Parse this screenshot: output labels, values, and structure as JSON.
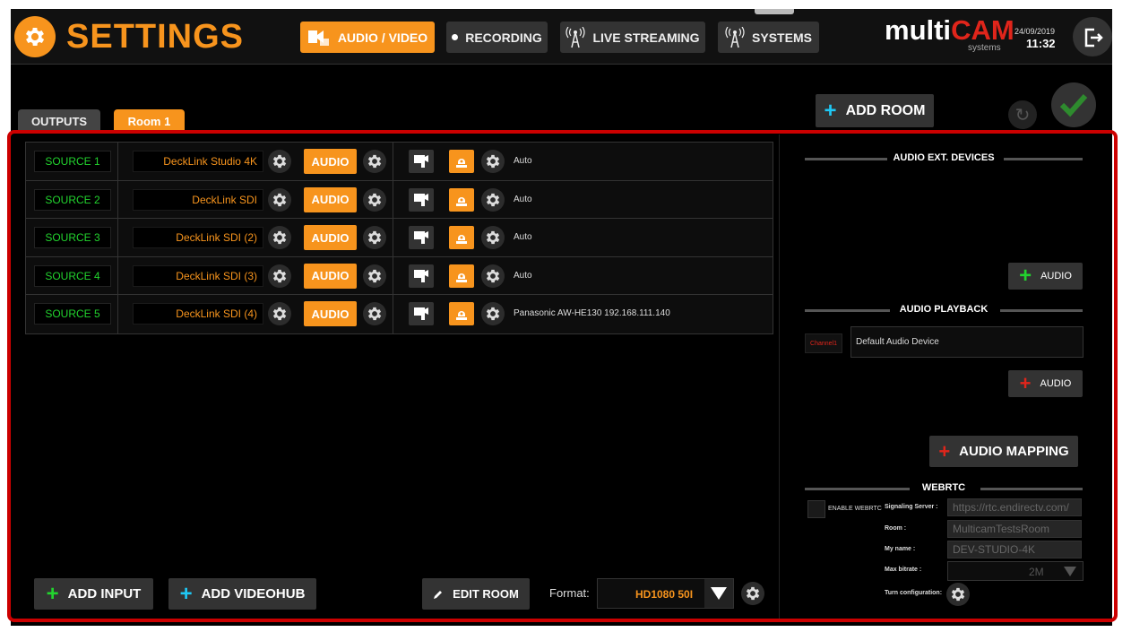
{
  "header": {
    "title": "SETTINGS",
    "nav": [
      {
        "label": "AUDIO / VIDEO",
        "icon": "speaker-video-icon",
        "active": true
      },
      {
        "label": "RECORDING",
        "icon": "record-dot-icon",
        "active": false
      },
      {
        "label": "LIVE STREAMING",
        "icon": "antenna-icon",
        "active": false
      },
      {
        "label": "SYSTEMS",
        "icon": "antenna-icon",
        "active": false
      }
    ],
    "brand_main": "multi",
    "brand_accent": "CAM",
    "brand_sub": "systems",
    "date": "24/09/2019",
    "time": "11:32"
  },
  "tabs": {
    "outputs": "OUTPUTS",
    "room": "Room 1"
  },
  "toolbar": {
    "add_room": "ADD ROOM"
  },
  "sources": [
    {
      "name": "SOURCE 1",
      "device": "DeckLink Studio 4K",
      "audio": "AUDIO",
      "control": "Auto"
    },
    {
      "name": "SOURCE 2",
      "device": "DeckLink SDI",
      "audio": "AUDIO",
      "control": "Auto"
    },
    {
      "name": "SOURCE 3",
      "device": "DeckLink SDI (2)",
      "audio": "AUDIO",
      "control": "Auto"
    },
    {
      "name": "SOURCE 4",
      "device": "DeckLink SDI (3)",
      "audio": "AUDIO",
      "control": "Auto"
    },
    {
      "name": "SOURCE 5",
      "device": "DeckLink SDI (4)",
      "audio": "AUDIO",
      "control": "Panasonic AW-HE130 192.168.111.140"
    }
  ],
  "bottom": {
    "add_input": "ADD INPUT",
    "add_videohub": "ADD VIDEOHUB",
    "edit_room": "EDIT ROOM",
    "format_label": "Format:",
    "format_value": "HD1080 50I"
  },
  "right": {
    "audio_ext_title": "AUDIO EXT. DEVICES",
    "add_audio_ext": "AUDIO",
    "audio_playback_title": "AUDIO PLAYBACK",
    "channel": "Channel1",
    "playback_device": "Default Audio Device",
    "add_audio_playback": "AUDIO",
    "audio_mapping": "AUDIO MAPPING",
    "webrtc_title": "WEBRTC",
    "enable_webrtc": "ENABLE WEBRTC",
    "signaling_label": "Signaling Server :",
    "signaling_value": "https://rtc.endirectv.com/",
    "room_label": "Room :",
    "room_value": "MulticamTestsRoom",
    "myname_label": "My name :",
    "myname_value": "DEV-STUDIO-4K",
    "bitrate_label": "Max bitrate :",
    "bitrate_value": "2M",
    "turn_label": "Turn configuration:"
  },
  "colors": {
    "accent": "#f7941d",
    "source_green": "#22d32e",
    "brand_red": "#e0251b",
    "plus_cyan": "#1ec8f5",
    "frame_red": "#cc0000"
  }
}
